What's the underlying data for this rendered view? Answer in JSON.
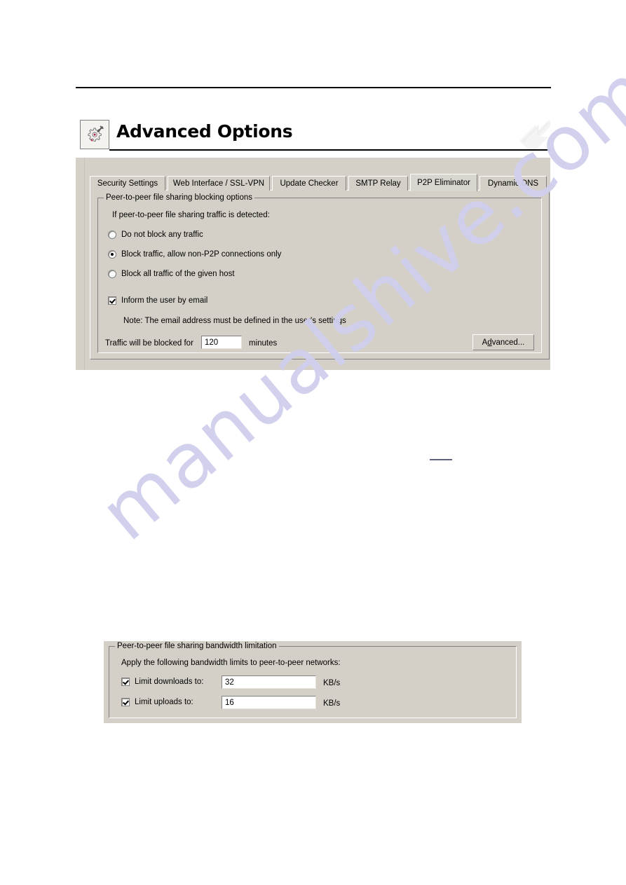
{
  "dialog": {
    "title": "Advanced Options",
    "icon": "gear-hammer-icon",
    "corner_icon": "arrow-corner-watermark-icon",
    "tabs": [
      {
        "label": "Security Settings",
        "active": false
      },
      {
        "label": "Web Interface / SSL-VPN",
        "active": false
      },
      {
        "label": "Update Checker",
        "active": false
      },
      {
        "label": "SMTP Relay",
        "active": false
      },
      {
        "label": "P2P Eliminator",
        "active": true
      },
      {
        "label": "Dynamic DNS",
        "active": false
      }
    ],
    "blocking_group": {
      "title": "Peer-to-peer file sharing blocking options",
      "prompt": "If peer-to-peer file sharing traffic is detected:",
      "radios": [
        {
          "label": "Do not block any traffic",
          "checked": false
        },
        {
          "label": "Block traffic, allow non-P2P connections only",
          "checked": true
        },
        {
          "label": "Block all traffic of the given host",
          "checked": false
        }
      ],
      "inform_checkbox": {
        "label": "Inform the user by email",
        "checked": true
      },
      "note": "Note: The email address must be defined in the user's settings",
      "duration_label": "Traffic will be blocked for",
      "duration_value": "120",
      "duration_unit": "minutes",
      "advanced_button": {
        "accel": "A",
        "rest_prefix": "d",
        "label_full": "Advanced...",
        "label_head": "A",
        "label_accel": "d",
        "label_tail": "vanced..."
      }
    }
  },
  "bandwidth_panel": {
    "title": "Peer-to-peer file sharing bandwidth limitation",
    "prompt": "Apply the following bandwidth limits to peer-to-peer networks:",
    "rows": [
      {
        "label": "Limit downloads to:",
        "checked": true,
        "value": "32",
        "unit": "KB/s"
      },
      {
        "label": "Limit uploads to:",
        "checked": true,
        "value": "16",
        "unit": "KB/s"
      }
    ]
  },
  "watermark": {
    "text": "manualshive.com"
  },
  "colors": {
    "window_face": "#d4d0c8",
    "header_bg": "#ffffff",
    "field_bg": "#ffffff",
    "text": "#000000",
    "watermark": "#cfcfee"
  }
}
